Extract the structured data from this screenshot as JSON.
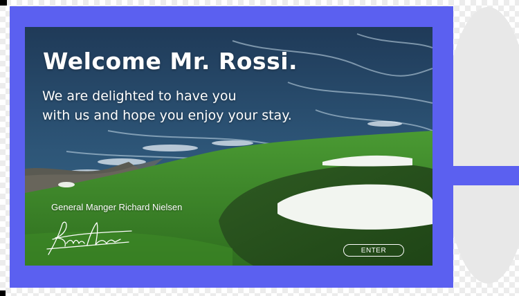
{
  "welcome": {
    "title": "Welcome Mr. Rossi.",
    "message_line1": "We are delighted to have you",
    "message_line2": "with us and hope you enjoy your stay."
  },
  "signoff": {
    "signer": "General Manger Richard Nielsen"
  },
  "actions": {
    "enter_label": "ENTER"
  },
  "colors": {
    "frame": "#5b60f0",
    "text": "#ffffff",
    "ocean": "#2a4a68",
    "fairway": "#3f8a2a"
  },
  "icons": {
    "signature": "handwritten-signature"
  }
}
